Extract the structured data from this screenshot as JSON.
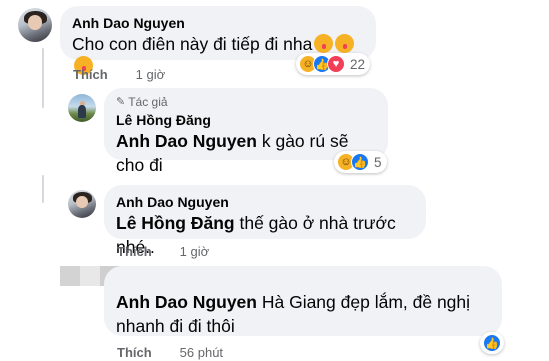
{
  "comments": [
    {
      "author": "Anh Dao Nguyen",
      "text": "Cho con điên này đi tiếp đi nha",
      "like_label": "Thích",
      "time": "1 giờ",
      "reaction_count": "22"
    },
    {
      "badge": "Tác giả",
      "author": "Lê Hồng Đăng",
      "mention": "Anh Dao Nguyen",
      "text": " k gào rú sẽ cho đi",
      "reaction_count": "5"
    },
    {
      "author": "Anh Dao Nguyen",
      "mention": "Lê Hồng Đăng",
      "text": " thế gào ở nhà trước nhé..",
      "like_label": "Thích",
      "time": "1 giờ"
    },
    {
      "mention": "Anh Dao Nguyen",
      "text": " Hà Giang đẹp lắm, đề nghị nhanh đi đi thôi",
      "like_label": "Thích",
      "time": "56 phút"
    }
  ],
  "colors": {
    "bubble": "#f0f2f5",
    "meta_text": "#65676b",
    "like_blue": "#1877f2",
    "haha_yellow": "#f7b125",
    "love_red": "#f33e58"
  },
  "icons": [
    "pen-icon",
    "haha-reaction-icon",
    "like-reaction-icon",
    "love-reaction-icon",
    "kiss-emoji-icon"
  ]
}
